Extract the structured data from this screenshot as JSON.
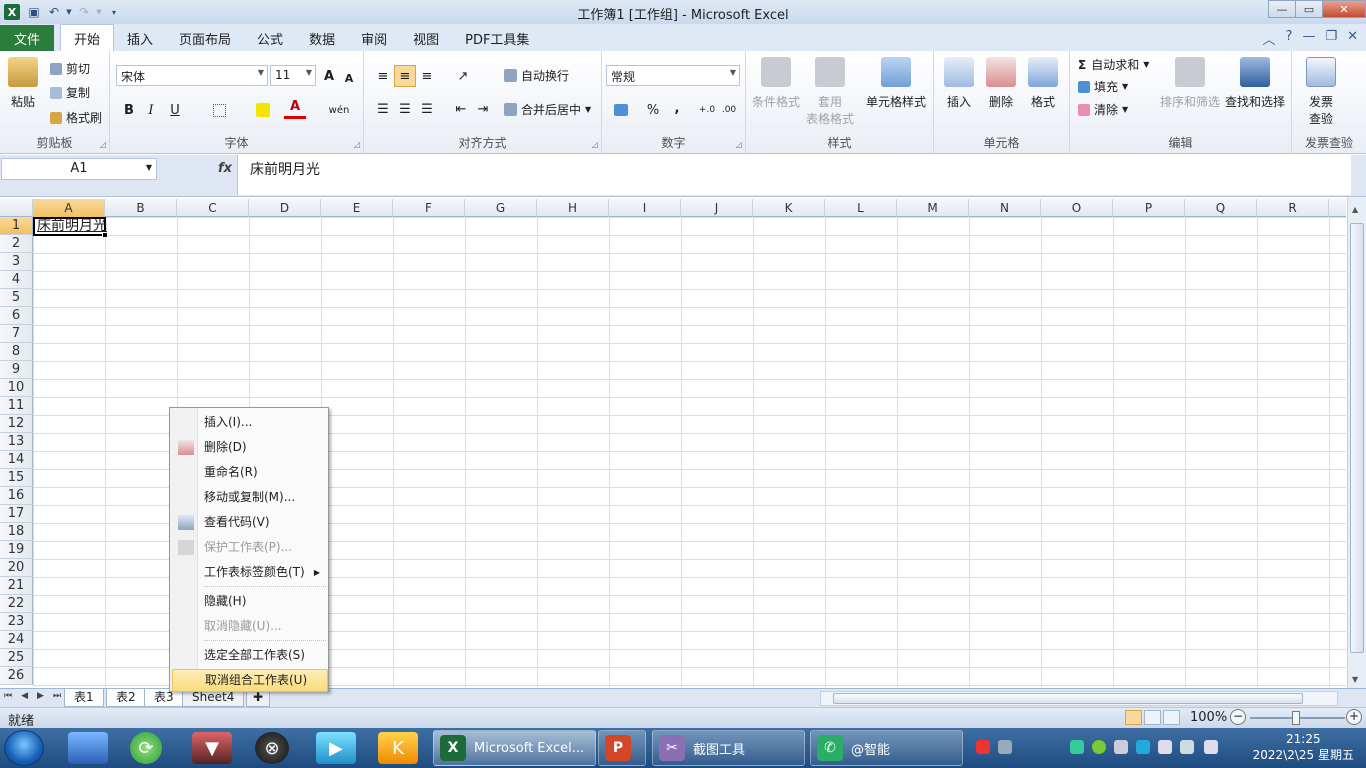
{
  "window": {
    "title": "工作簿1  [工作组]  - Microsoft Excel",
    "logo": "X"
  },
  "tabs": [
    {
      "label": "文件"
    },
    {
      "label": "开始"
    },
    {
      "label": "插入"
    },
    {
      "label": "页面布局"
    },
    {
      "label": "公式"
    },
    {
      "label": "数据"
    },
    {
      "label": "审阅"
    },
    {
      "label": "视图"
    },
    {
      "label": "PDF工具集"
    }
  ],
  "ribbon": {
    "clipboard": {
      "label": "剪贴板",
      "paste": "粘贴",
      "cut": "剪切",
      "copy": "复制",
      "format_painter": "格式刷"
    },
    "font": {
      "label": "字体",
      "name": "宋体",
      "size": "11",
      "bold": "B",
      "italic": "I",
      "underline": "U",
      "grow": "A",
      "shrink": "A",
      "color_a": "A",
      "wen": "wén"
    },
    "alignment": {
      "label": "对齐方式",
      "wrap": "自动换行",
      "merge": "合并后居中"
    },
    "number": {
      "label": "数字",
      "format": "常规",
      "percent": "%",
      "comma": ","
    },
    "styles": {
      "label": "样式",
      "conditional": "条件格式",
      "table_l1": "套用",
      "table_l2": "表格格式",
      "cell_styles": "单元格样式"
    },
    "cells": {
      "label": "单元格",
      "insert": "插入",
      "delete": "删除",
      "format": "格式"
    },
    "editing": {
      "label": "编辑",
      "autosum": "自动求和",
      "sigma": "Σ",
      "fill": "填充",
      "clear": "清除",
      "sort": "排序和筛选",
      "find": "查找和选择"
    },
    "invoice": {
      "label": "发票查验",
      "btn_l1": "发票",
      "btn_l2": "查验"
    }
  },
  "formula": {
    "namebox": "A1",
    "fx": "fx",
    "content": "床前明月光"
  },
  "grid": {
    "columns": [
      "A",
      "B",
      "C",
      "D",
      "E",
      "F",
      "G",
      "H",
      "I",
      "J",
      "K",
      "L",
      "M",
      "N",
      "O",
      "P",
      "Q",
      "R"
    ],
    "rows": [
      "1",
      "2",
      "3",
      "4",
      "5",
      "6",
      "7",
      "8",
      "9",
      "10",
      "11",
      "12",
      "13",
      "14",
      "15",
      "16",
      "17",
      "18",
      "19",
      "20",
      "21",
      "22",
      "23",
      "24",
      "25",
      "26"
    ],
    "a1": "床前明月光"
  },
  "context_menu": [
    {
      "label": "插入(I)...",
      "disabled": false
    },
    {
      "label": "删除(D)",
      "disabled": false
    },
    {
      "label": "重命名(R)",
      "disabled": false
    },
    {
      "label": "移动或复制(M)...",
      "disabled": false
    },
    {
      "label": "查看代码(V)",
      "disabled": false
    },
    {
      "label": "保护工作表(P)...",
      "disabled": true
    },
    {
      "label": "工作表标签颜色(T)",
      "disabled": false
    },
    {
      "label": "隐藏(H)",
      "disabled": false
    },
    {
      "label": "取消隐藏(U)...",
      "disabled": true
    },
    {
      "label": "选定全部工作表(S)",
      "disabled": false
    },
    {
      "label": "取消组合工作表(U)",
      "disabled": false
    }
  ],
  "sheets": [
    {
      "label": "表1"
    },
    {
      "label": "表2"
    },
    {
      "label": "表3"
    },
    {
      "label": "Sheet4"
    }
  ],
  "status": {
    "ready": "就绪",
    "zoom": "100%",
    "minus": "−",
    "plus": "+"
  },
  "taskbar": {
    "tasks": [
      {
        "label": "Microsoft Excel...",
        "icon": "X"
      },
      {
        "label": "",
        "icon": "P"
      },
      {
        "label": "截图工具",
        "icon": "✂"
      },
      {
        "label": "@智能",
        "icon": "✆"
      }
    ],
    "clock_time": "21:25",
    "clock_date": "2022\\2\\25 星期五"
  },
  "colors": {
    "accent": "#2a7d3c",
    "ribbon_bg": "#dfe9f5",
    "highlight": "#fbdc7c"
  }
}
